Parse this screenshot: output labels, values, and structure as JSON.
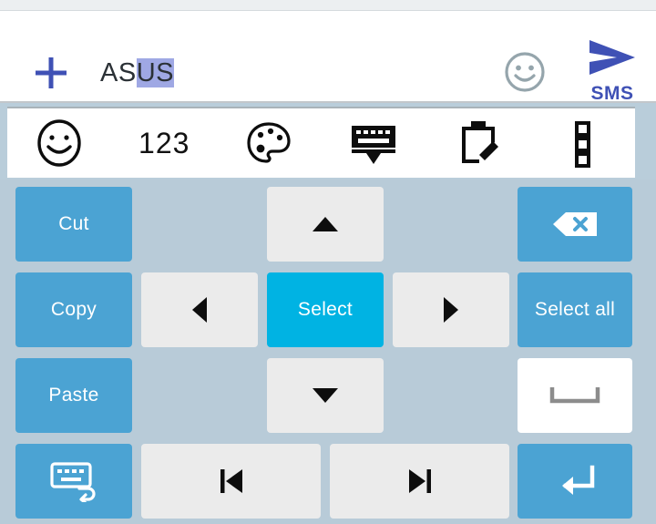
{
  "app": {
    "screen": "sms-compose-with-keyboard-text-editing-panel"
  },
  "compose": {
    "add_icon": "plus-icon",
    "message_value": "ASUS",
    "message_text_unselected": "AS",
    "message_text_selected": "US",
    "selection_highlight_color": "#9fa8e4",
    "emoji_icon": "smiley-face-icon",
    "send_icon": "send-arrow-icon",
    "send_label": "SMS",
    "send_color": "#3f51b5"
  },
  "toolbar": {
    "items": [
      {
        "icon": "smiley-face-icon",
        "label": ""
      },
      {
        "icon": "numbers-icon",
        "label": "123"
      },
      {
        "icon": "palette-icon",
        "label": ""
      },
      {
        "icon": "hide-keyboard-icon",
        "label": ""
      },
      {
        "icon": "clipboard-edit-icon",
        "label": ""
      },
      {
        "icon": "overflow-menu-icon",
        "label": ""
      }
    ],
    "numbers_label": "123"
  },
  "keyboard": {
    "background_color": "#b8cbd8",
    "key_blue": "#4ba3d3",
    "key_cyan": "#00b3e3",
    "key_grey": "#ebebeb",
    "key_white": "#ffffff",
    "keys": {
      "cut": "Cut",
      "copy": "Copy",
      "paste": "Paste",
      "select": "Select",
      "select_all": "Select all",
      "backspace_icon": "backspace-icon",
      "arrow_up_icon": "arrow-up-icon",
      "arrow_down_icon": "arrow-down-icon",
      "arrow_left_icon": "arrow-left-icon",
      "arrow_right_icon": "arrow-right-icon",
      "space_icon": "spacebar-icon",
      "enter_icon": "enter-return-icon",
      "keyboard_switch_icon": "keyboard-back-icon",
      "jump_start_icon": "skip-to-start-icon",
      "jump_end_icon": "skip-to-end-icon"
    }
  }
}
